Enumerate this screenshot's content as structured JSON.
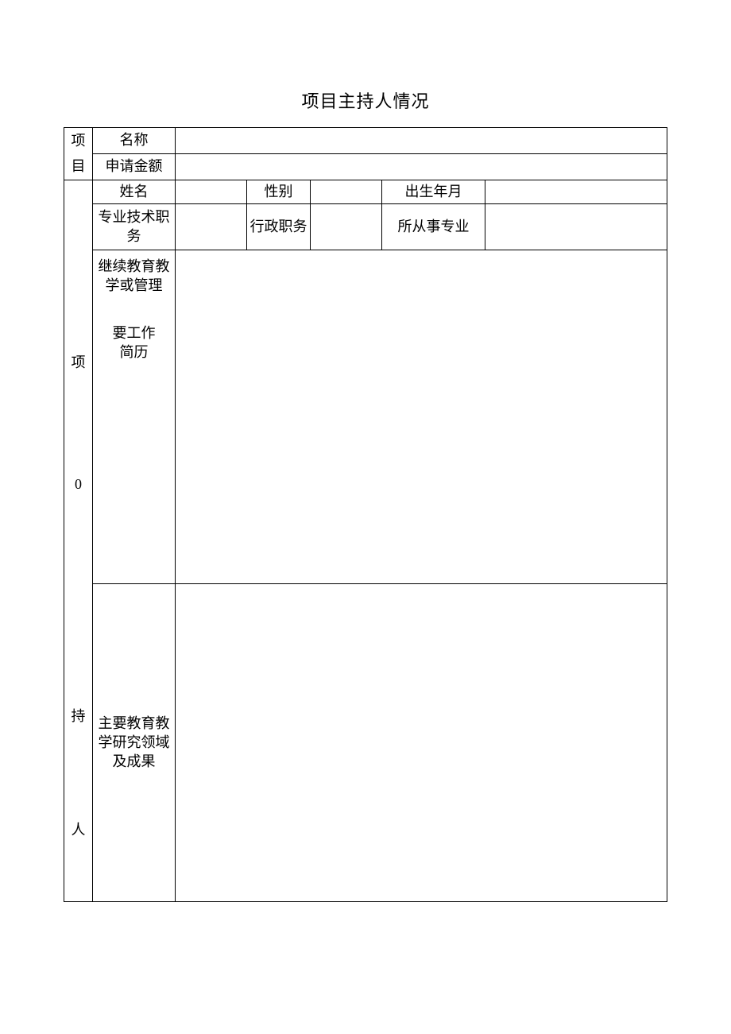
{
  "title": "项目主持人情况",
  "side": {
    "project_char1": "项",
    "project_char2": "目",
    "host_char1": "项",
    "host_char2": "0",
    "host_char3": "持",
    "host_char4": "人"
  },
  "labels": {
    "name": "名称",
    "amount": "申请金额",
    "person_name": "姓名",
    "gender": "性别",
    "birth": "出生年月",
    "prof_title": "专业技术职务",
    "admin_title": "行政职务",
    "specialty": "所从事专业",
    "resume_l1": "继续教育教",
    "resume_l2": "学或管理",
    "resume_l3": "要工作",
    "resume_l4": "简历",
    "research_l1": "主要教育教",
    "research_l2": "学研究领域",
    "research_l3": "及成果"
  },
  "values": {
    "name": "",
    "amount": "",
    "person_name": "",
    "gender": "",
    "birth": "",
    "prof_title": "",
    "admin_title": "",
    "specialty": "",
    "resume": "",
    "research": ""
  }
}
